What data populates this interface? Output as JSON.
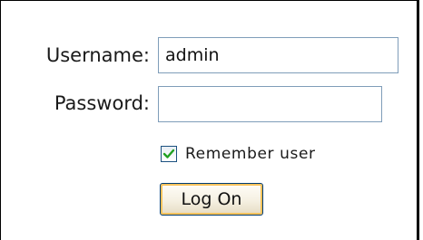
{
  "login_form": {
    "username_label": "Username:",
    "username_value": "admin",
    "password_label": "Password:",
    "password_value": "",
    "remember_label": "Remember user",
    "remember_checked": true,
    "submit_label": "Log On"
  },
  "colors": {
    "input_border": "#7f9db9",
    "checkbox_check": "#21a121",
    "button_focus_ring": "#f6c25c",
    "button_border": "#003c74"
  }
}
